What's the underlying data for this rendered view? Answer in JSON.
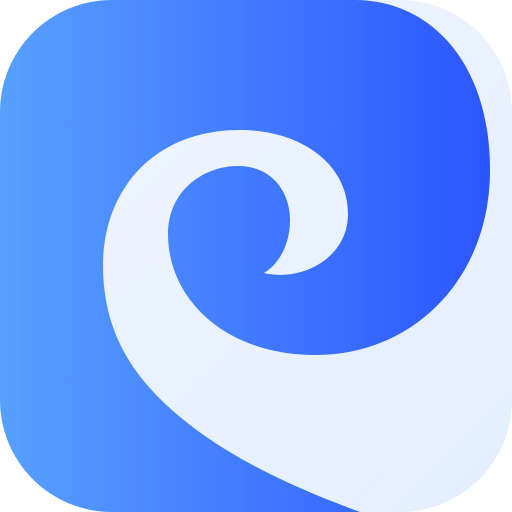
{
  "app_icon": {
    "icon_name": "wave-swirl-icon",
    "colors": {
      "gradient_start": "#58A0FF",
      "gradient_end": "#2B56FF",
      "swirl_light": "#F1F6FF",
      "swirl_shade": "#E3EEFF",
      "background": "#FFFFFF"
    }
  }
}
